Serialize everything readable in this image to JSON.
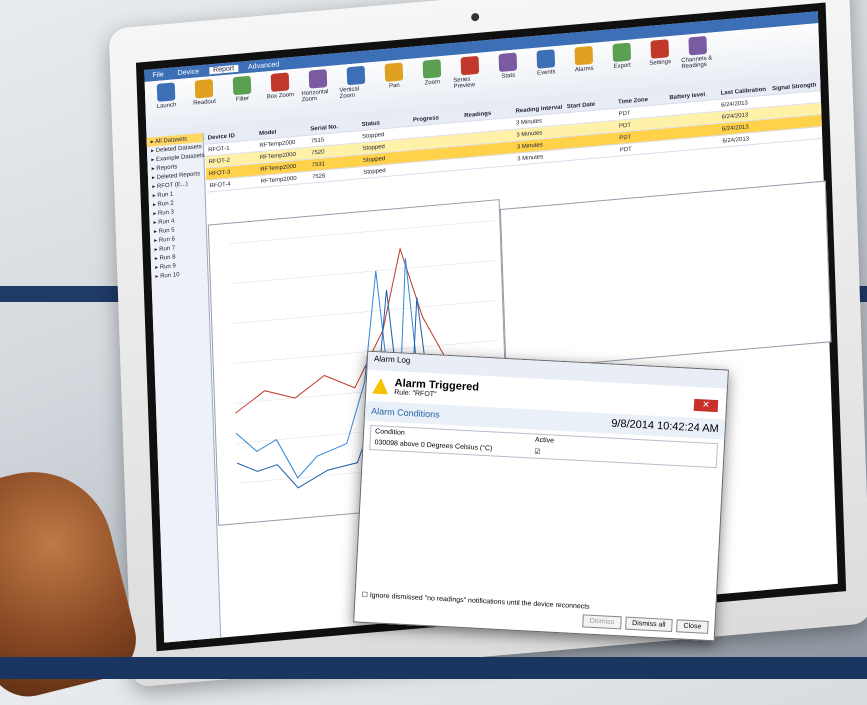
{
  "tabs": [
    "File",
    "Device",
    "Report",
    "Advanced"
  ],
  "ribbon": {
    "buttons": [
      "Launch",
      "Readout",
      "Filter",
      "Box Zoom",
      "Horizontal Zoom",
      "Vertical Zoom",
      "Pan",
      "Zoom",
      "Series Preview",
      "Stats",
      "Events",
      "Alarms",
      "Export",
      "Settings",
      "Channels & Readings"
    ]
  },
  "tree": {
    "items": [
      "All Datasets",
      "Deleted Datasets",
      "Example Datasets",
      "Reports",
      "Deleted Reports",
      "RFOT (E...)",
      "Run 1",
      "Run 2",
      "Run 3",
      "Run 4",
      "Run 5",
      "Run 6",
      "Run 7",
      "Run 8",
      "Run 9",
      "Run 10"
    ]
  },
  "grid": {
    "headers": [
      "Device ID",
      "Model",
      "Serial No.",
      "Status",
      "Progress",
      "Readings",
      "Reading Interval",
      "Start Date",
      "Time Zone",
      "Battery level",
      "Last Calibration",
      "Signal Strength"
    ],
    "rows": [
      [
        "RFOT-1",
        "RFTemp2000",
        "7515",
        "Stopped",
        "",
        "",
        "3 Minutes",
        "",
        "PDT",
        "",
        "6/24/2013",
        ""
      ],
      [
        "RFOT-2",
        "RFTemp2000",
        "7520",
        "Stopped",
        "",
        "",
        "3 Minutes",
        "",
        "PDT",
        "",
        "6/24/2013",
        ""
      ],
      [
        "RFOT-3",
        "RFTemp2000",
        "7531",
        "Stopped",
        "",
        "",
        "3 Minutes",
        "",
        "PDT",
        "",
        "6/24/2013",
        ""
      ],
      [
        "RFOT-4",
        "RFTemp2000",
        "7526",
        "Stopped",
        "",
        "",
        "3 Minutes",
        "",
        "PDT",
        "",
        "6/24/2013",
        ""
      ]
    ]
  },
  "dialog": {
    "window_title": "Alarm Log",
    "title": "Alarm Triggered",
    "rule": "Rule: \"RFOT\"",
    "conditions_label": "Alarm Conditions",
    "date": "9/8/2014 10:42:24 AM",
    "col_condition": "Condition",
    "col_active": "Active",
    "condition_text": "030098 above 0 Degrees Celsius (°C)",
    "ignore_text": "Ignore dismissed \"no readings\" notifications until the device reconnects",
    "dismiss": "Dismiss",
    "dismiss_all": "Dismiss all",
    "close": "Close"
  },
  "colors": {
    "accent": "#3d6fb6",
    "highlight": "#ffd24a",
    "navy": "#1f3a67"
  }
}
